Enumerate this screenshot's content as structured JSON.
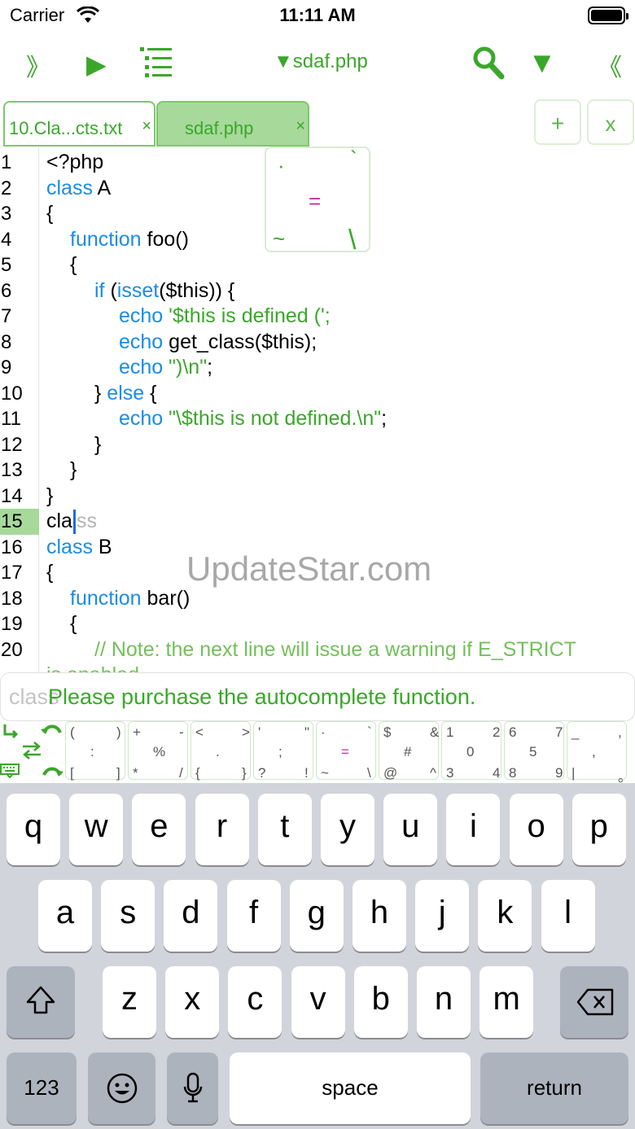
{
  "status_bar": {
    "carrier": "Carrier",
    "time": "11:11 AM"
  },
  "toolbar": {
    "expand_left": "》",
    "play": "▶",
    "file_title": "▼sdaf.php",
    "filter": "▼",
    "collapse_right": "《"
  },
  "tabs": [
    {
      "label": "10.Cla...cts.txt",
      "close": "×"
    },
    {
      "label": "sdaf.php",
      "close": "×"
    }
  ],
  "tab_actions": {
    "add": "+",
    "close": "x"
  },
  "symbol_popup": {
    "items": [
      "·",
      "`",
      "=",
      "~",
      "\\"
    ]
  },
  "editor": {
    "current_line": 15,
    "lines": [
      {
        "num": "1"
      },
      {
        "num": "2"
      },
      {
        "num": "3"
      },
      {
        "num": "4"
      },
      {
        "num": "5"
      },
      {
        "num": "6"
      },
      {
        "num": "7"
      },
      {
        "num": "8"
      },
      {
        "num": "9"
      },
      {
        "num": "10"
      },
      {
        "num": "11"
      },
      {
        "num": "12"
      },
      {
        "num": "13"
      },
      {
        "num": "14"
      },
      {
        "num": "15"
      },
      {
        "num": "16"
      },
      {
        "num": "17"
      },
      {
        "num": "18"
      },
      {
        "num": "19"
      },
      {
        "num": "20"
      }
    ],
    "code": {
      "l1": "<?php",
      "l2_kw": "class",
      "l2_rest": " A",
      "l3": "{",
      "l4_kw": "function",
      "l4_rest": " foo()",
      "l5": "{",
      "l6_kw": "if",
      "l6_a": " (",
      "l6_kw2": "isset",
      "l6_b": "($this)) {",
      "l7_kw": "echo",
      "l7_str": " '$this is defined (';",
      "l8_kw": "echo",
      "l8_rest": " get_class($this);",
      "l9_kw": "echo",
      "l9_str": " \")\\n\"",
      "l9_end": ";",
      "l10_a": "} ",
      "l10_kw": "else",
      "l10_b": " {",
      "l11_kw": "echo",
      "l11_str": " \"\\$this is not defined.\\n\"",
      "l11_end": ";",
      "l12": "}",
      "l13": "}",
      "l14": "}",
      "l15_typed": "cla",
      "l15_ghost": "ss",
      "l16_kw": "class",
      "l16_rest": " B",
      "l17": "{",
      "l18_kw": "function",
      "l18_rest": " bar()",
      "l19": "{",
      "l20": "// Note: the next line will issue a warning if E_STRICT",
      "l21": "is enabled."
    }
  },
  "watermark": "UpdateStar.com",
  "autocomplete_banner": {
    "ghost": "class",
    "message": "Please purchase the autocomplete function."
  },
  "symbol_keys": [
    [
      "( ) : [ ]"
    ],
    [
      "+ - % * /"
    ],
    [
      "< > . { }"
    ],
    [
      "' \" ; ? !"
    ],
    [
      "· ` = ~ \\"
    ],
    [
      "$ & # @ ^"
    ],
    [
      "1 2 0 3 4"
    ],
    [
      "6 7 5 8 9"
    ],
    [
      "_ , , | 。"
    ]
  ],
  "symbol_grid": [
    [
      "(",
      ")",
      ":",
      "[",
      "]"
    ],
    [
      "+",
      "-",
      "%",
      "*",
      "/"
    ],
    [
      "<",
      ">",
      ".",
      "{",
      "}"
    ],
    [
      "'",
      "\"",
      ";",
      "?",
      "!"
    ],
    [
      "·",
      "`",
      "=",
      "~",
      "\\"
    ],
    [
      "$",
      "&",
      "#",
      "@",
      "^"
    ],
    [
      "1",
      "2",
      "0",
      "3",
      "4"
    ],
    [
      "6",
      "7",
      "5",
      "8",
      "9"
    ],
    [
      "_",
      ",",
      ",",
      "|",
      "。"
    ]
  ],
  "keyboard": {
    "row1": [
      "q",
      "w",
      "e",
      "r",
      "t",
      "y",
      "u",
      "i",
      "o",
      "p"
    ],
    "row2": [
      "a",
      "s",
      "d",
      "f",
      "g",
      "h",
      "j",
      "k",
      "l"
    ],
    "row3": [
      "z",
      "x",
      "c",
      "v",
      "b",
      "n",
      "m"
    ],
    "numbers": "123",
    "space": "space",
    "return": "return"
  },
  "colors": {
    "accent": "#3aa72a",
    "keyword": "#1a8ce6",
    "current_line": "#a6d99a",
    "keyboard_bg": "#d1d4da"
  }
}
